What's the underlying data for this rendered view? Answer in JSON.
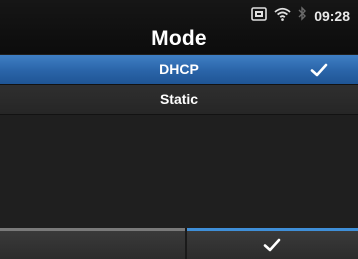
{
  "header": {
    "title": "Mode",
    "time": "09:28"
  },
  "status_icons": [
    "sd-card-icon",
    "wifi-icon",
    "bluetooth-icon"
  ],
  "list": {
    "items": [
      {
        "label": "DHCP",
        "selected": true
      },
      {
        "label": "Static",
        "selected": false
      }
    ]
  },
  "softkeys": {
    "left_icon": "",
    "right_icon": "checkmark-icon"
  },
  "colors": {
    "accent": "#2a64a8",
    "background": "#1f1f1f",
    "softkey_active_bar": "#3f8fd8"
  }
}
